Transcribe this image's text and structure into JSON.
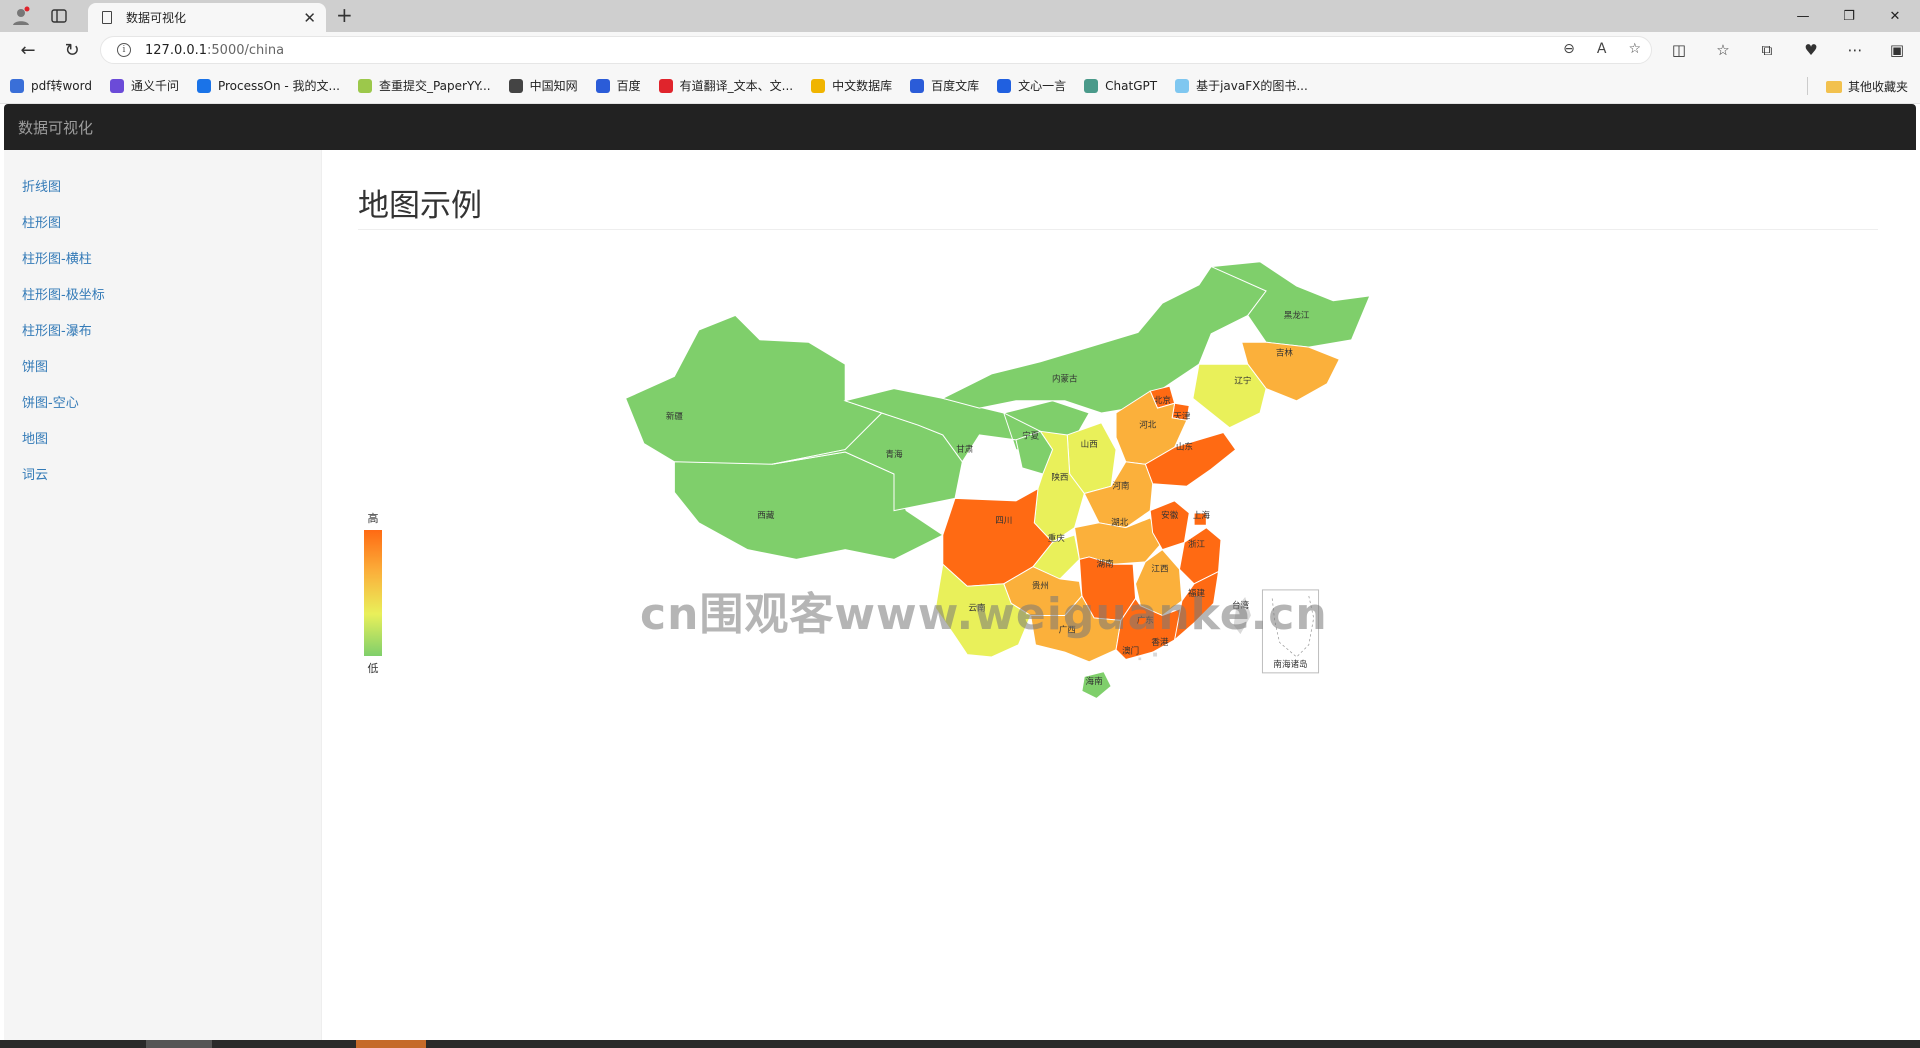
{
  "browser": {
    "tab_title": "数据可视化",
    "url_host": "127.0.0.1",
    "url_rest": ":5000/china",
    "bookmarks": [
      {
        "label": "pdf转word",
        "color": "#3a6fd8",
        "icon": "pdf-logo-icon"
      },
      {
        "label": "通义千问",
        "color": "#6b4bd8",
        "icon": "tongyi-logo-icon"
      },
      {
        "label": "ProcessOn - 我的文...",
        "color": "#1a73e8",
        "icon": "processon-logo-icon"
      },
      {
        "label": "查重提交_PaperYY...",
        "color": "#9cc84b",
        "icon": "paperyy-logo-icon"
      },
      {
        "label": "中国知网",
        "color": "#444444",
        "icon": "cnki-logo-icon"
      },
      {
        "label": "百度",
        "color": "#2b5cd8",
        "icon": "baidu-logo-icon"
      },
      {
        "label": "有道翻译_文本、文...",
        "color": "#e0242c",
        "icon": "youdao-logo-icon"
      },
      {
        "label": "中文数据库",
        "color": "#f0b400",
        "icon": "location-pin-icon"
      },
      {
        "label": "百度文库",
        "color": "#2b5cd8",
        "icon": "baidu-wenku-logo-icon"
      },
      {
        "label": "文心一言",
        "color": "#2060e0",
        "icon": "wenxin-logo-icon"
      },
      {
        "label": "ChatGPT",
        "color": "#4a9a8a",
        "icon": "chatgpt-logo-icon"
      },
      {
        "label": "基于javaFX的图书...",
        "color": "#7fc7f0",
        "icon": "page-icon"
      }
    ],
    "other_bookmarks": "其他收藏夹"
  },
  "app": {
    "brand": "数据可视化",
    "sidebar": [
      "折线图",
      "柱形图",
      "柱形图-横柱",
      "柱形图-极坐标",
      "柱形图-瀑布",
      "饼图",
      "饼图-空心",
      "地图",
      "词云"
    ],
    "page_title": "地图示例",
    "watermark": "cn围观客www.weiguanke.cn"
  },
  "chart_data": {
    "type": "map",
    "visual_map": {
      "high_label": "高",
      "low_label": "低",
      "colors": [
        "#7fcf6b",
        "#e9f05a",
        "#fbb03b",
        "#ff6a13"
      ]
    },
    "regions": [
      {
        "name": "新疆",
        "level": "low"
      },
      {
        "name": "西藏",
        "level": "low"
      },
      {
        "name": "青海",
        "level": "low"
      },
      {
        "name": "甘肃",
        "level": "low"
      },
      {
        "name": "内蒙古",
        "level": "low"
      },
      {
        "name": "黑龙江",
        "level": "low"
      },
      {
        "name": "吉林",
        "level": "high"
      },
      {
        "name": "辽宁",
        "level": "mid"
      },
      {
        "name": "宁夏",
        "level": "low"
      },
      {
        "name": "山西",
        "level": "mid"
      },
      {
        "name": "陕西",
        "level": "mid"
      },
      {
        "name": "北京",
        "level": "max"
      },
      {
        "name": "天津",
        "level": "max"
      },
      {
        "name": "河北",
        "level": "high"
      },
      {
        "name": "山东",
        "level": "max"
      },
      {
        "name": "河南",
        "level": "high"
      },
      {
        "name": "四川",
        "level": "max"
      },
      {
        "name": "重庆",
        "level": "mid"
      },
      {
        "name": "湖北",
        "level": "high"
      },
      {
        "name": "安徽",
        "level": "max"
      },
      {
        "name": "上海",
        "level": "max"
      },
      {
        "name": "浙江",
        "level": "max"
      },
      {
        "name": "湖南",
        "level": "max"
      },
      {
        "name": "江西",
        "level": "high"
      },
      {
        "name": "贵州",
        "level": "high"
      },
      {
        "name": "云南",
        "level": "mid"
      },
      {
        "name": "广西",
        "level": "high"
      },
      {
        "name": "广东",
        "level": "max"
      },
      {
        "name": "福建",
        "level": "max"
      },
      {
        "name": "台湾",
        "level": "none"
      },
      {
        "name": "香港",
        "level": "none"
      },
      {
        "name": "澳门",
        "level": "none"
      },
      {
        "name": "海南",
        "level": "low"
      },
      {
        "name": "南海诸岛",
        "level": "none"
      }
    ]
  }
}
